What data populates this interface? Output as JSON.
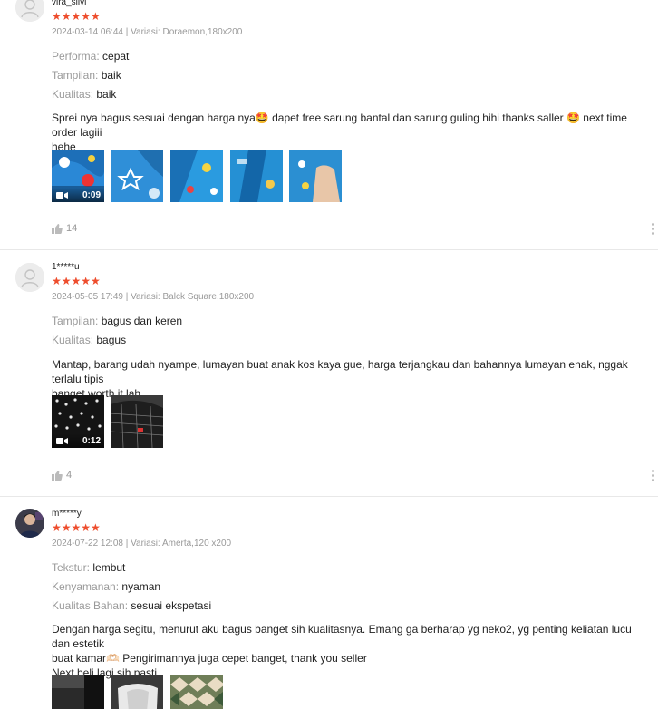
{
  "reviews": [
    {
      "username": "vira_silvi",
      "stars": "★★★★★",
      "meta": "2024-03-14 06:44 | Variasi: Doraemon,180x200",
      "attributes": [
        {
          "key": "Performa:",
          "value": "cepat"
        },
        {
          "key": "Tampilan:",
          "value": "baik"
        },
        {
          "key": "Kualitas:",
          "value": "baik"
        }
      ],
      "comment_line1": "Sprei nya bagus sesuai dengan harga nya🤩 dapet free sarung bantal dan sarung guling hihi thanks saller 🤩 next time order lagiii",
      "comment_line2": "hehe",
      "video_duration": "0:09",
      "likes": "14"
    },
    {
      "username": "1*****u",
      "stars": "★★★★★",
      "meta": "2024-05-05 17:49 | Variasi: Balck Square,180x200",
      "attributes": [
        {
          "key": "Tampilan:",
          "value": "bagus dan keren"
        },
        {
          "key": "Kualitas:",
          "value": "bagus"
        }
      ],
      "comment_line1": "Mantap, barang udah nyampe, lumayan buat anak kos kaya gue, harga terjangkau dan bahannya lumayan enak, nggak terlalu tipis",
      "comment_line2": "banget worth it lah",
      "video_duration": "0:12",
      "likes": "4"
    },
    {
      "username": "m*****y",
      "stars": "★★★★★",
      "meta": "2024-07-22 12:08 | Variasi: Amerta,120 x200",
      "attributes": [
        {
          "key": "Tekstur:",
          "value": "lembut"
        },
        {
          "key": "Kenyamanan:",
          "value": "nyaman"
        },
        {
          "key": "Kualitas Bahan:",
          "value": "sesuai ekspetasi"
        }
      ],
      "comment_line1": "Dengan harga segitu, menurut aku bagus banget sih kualitasnya. Emang ga berharap yg neko2, yg penting keliatan lucu dan estetik",
      "comment_line2": "buat kamar🫶🏻 Pengirimannya juga cepet banget, thank you seller",
      "comment_line3": "Next beli lagi sih pasti"
    }
  ],
  "colors": {
    "star": "#ee4d2d",
    "muted": "#999999",
    "divider": "#e8e8e8"
  }
}
